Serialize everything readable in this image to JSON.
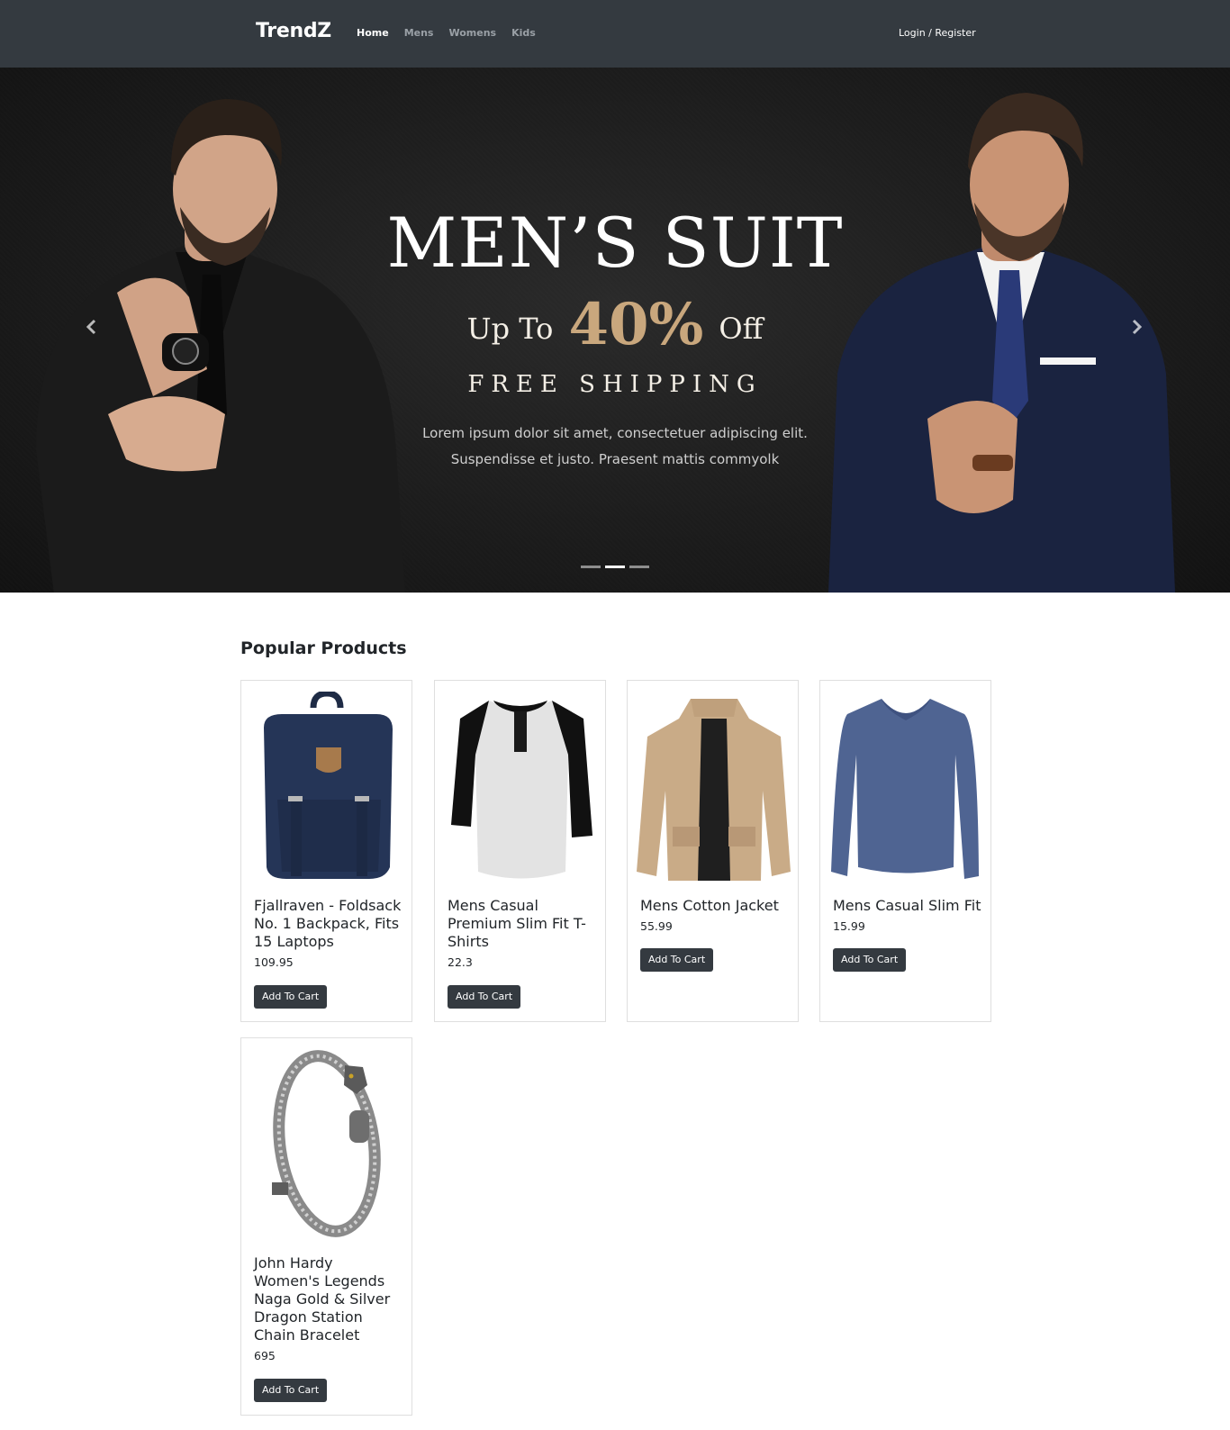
{
  "navbar": {
    "brand": "TrendZ",
    "links": [
      "Home",
      "Mens",
      "Womens",
      "Kids"
    ],
    "active_link": "Home",
    "login": "Login / Register"
  },
  "hero": {
    "title": "MEN’S SUIT",
    "offer_prefix": "Up To",
    "offer_value": "40%",
    "offer_suffix": "Off",
    "shipping": "FREE SHIPPING",
    "description": "Lorem ipsum dolor sit amet, consectetuer adipiscing elit. Suspendisse et justo. Praesent mattis commyolk",
    "slide_count": 3,
    "active_slide": 2
  },
  "products_section": {
    "title": "Popular Products",
    "products": [
      {
        "title": "Fjallraven - Foldsack No. 1 Backpack, Fits 15 Laptops",
        "price": "109.95",
        "button": "Add To Cart",
        "image": "backpack"
      },
      {
        "title": "Mens Casual Premium Slim Fit T-Shirts",
        "price": "22.3",
        "button": "Add To Cart",
        "image": "t-shirt"
      },
      {
        "title": "Mens Cotton Jacket",
        "price": "55.99",
        "button": "Add To Cart",
        "image": "jacket"
      },
      {
        "title": "Mens Casual Slim Fit",
        "price": "15.99",
        "button": "Add To Cart",
        "image": "long-sleeve-shirt"
      },
      {
        "title": "John Hardy Women's Legends Naga Gold & Silver Dragon Station Chain Bracelet",
        "price": "695",
        "button": "Add To Cart",
        "image": "bracelet"
      }
    ]
  },
  "colors": {
    "navbar": "#343a40",
    "hero_bg": "#1c1c1c",
    "accent_gold": "#c9a77d",
    "button": "#343a40"
  }
}
